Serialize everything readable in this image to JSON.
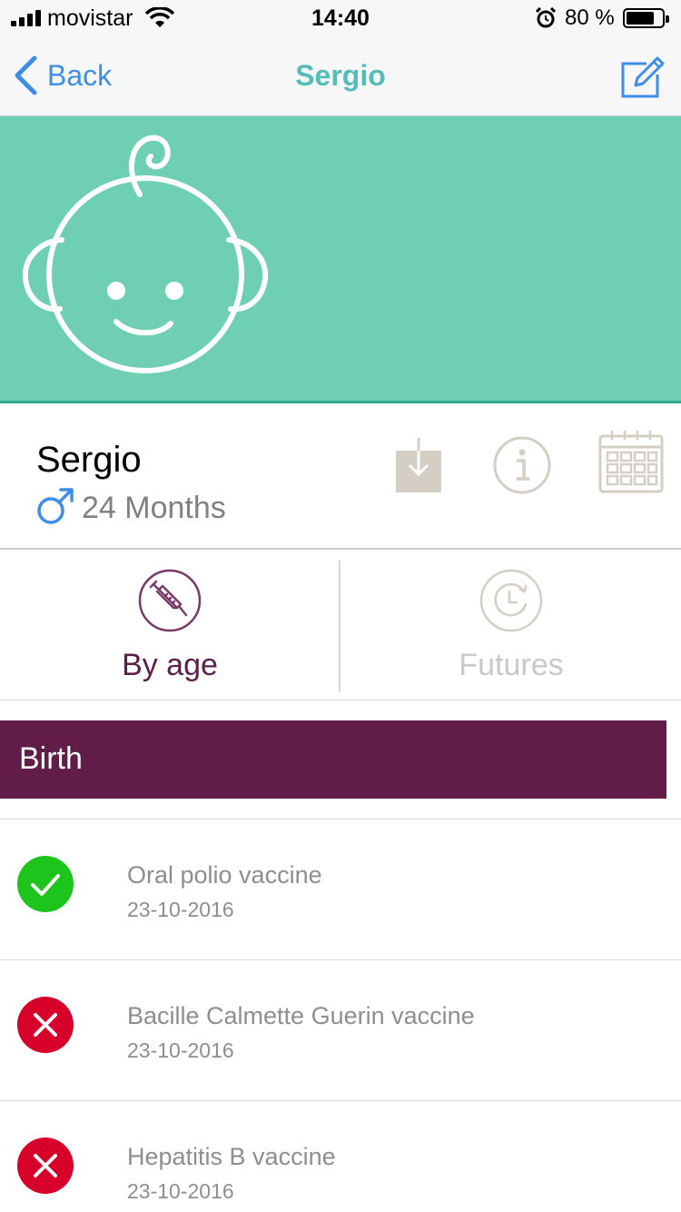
{
  "status_bar": {
    "carrier": "movistar",
    "time": "14:40",
    "battery_text": "80 %",
    "battery_level": 0.8,
    "icons": [
      "signal-icon",
      "wifi-icon",
      "alarm-icon",
      "battery-icon"
    ]
  },
  "nav": {
    "back_label": "Back",
    "title": "Sergio",
    "edit_icon": "edit-icon",
    "accent_color": "#3d8ee6",
    "title_color": "#56bcb8"
  },
  "hero": {
    "icon": "baby-face-icon",
    "background_color": "#6fcfb2"
  },
  "profile": {
    "name": "Sergio",
    "age": "24 Months",
    "gender_icon": "male-symbol-icon",
    "actions": [
      "download-icon",
      "info-icon",
      "calendar-icon"
    ]
  },
  "tabs": [
    {
      "label": "By age",
      "icon": "syringe-icon",
      "selected": true
    },
    {
      "label": "Futures",
      "icon": "clock-icon",
      "selected": false
    }
  ],
  "section": {
    "title": "Birth",
    "background_color": "#611d47"
  },
  "vaccines": [
    {
      "name": "Oral polio vaccine",
      "date": "23-10-2016",
      "status": "done",
      "status_icon": "check-icon",
      "status_color": "#1cc41c"
    },
    {
      "name": "Bacille Calmette Guerin vaccine",
      "date": "23-10-2016",
      "status": "missed",
      "status_icon": "close-icon",
      "status_color": "#d6002a"
    },
    {
      "name": "Hepatitis B vaccine",
      "date": "23-10-2016",
      "status": "missed",
      "status_icon": "close-icon",
      "status_color": "#d6002a"
    }
  ]
}
